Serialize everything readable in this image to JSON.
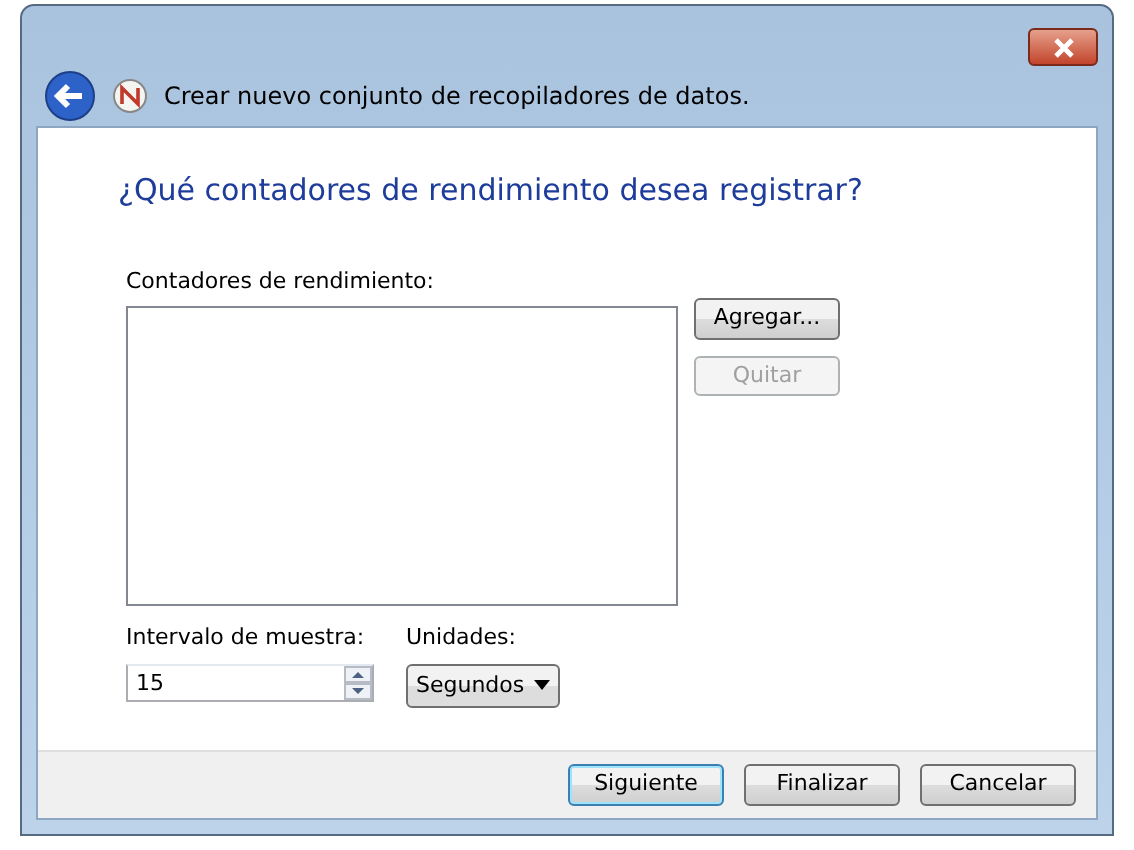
{
  "window": {
    "title": "Crear nuevo conjunto de recopiladores de datos."
  },
  "heading": "¿Qué contadores de rendimiento desea registrar?",
  "counters": {
    "label": "Contadores de rendimiento:",
    "buttons": [
      {
        "label": "Agregar...",
        "disabled": false
      },
      {
        "label": "Quitar",
        "disabled": true
      }
    ]
  },
  "interval": {
    "label": "Intervalo de muestra:",
    "value": "15"
  },
  "units": {
    "label": "Unidades:",
    "value": "Segundos"
  },
  "footer_buttons": [
    {
      "label": "Siguiente",
      "default": true
    },
    {
      "label": "Finalizar",
      "default": false
    },
    {
      "label": "Cancelar",
      "default": false
    }
  ]
}
